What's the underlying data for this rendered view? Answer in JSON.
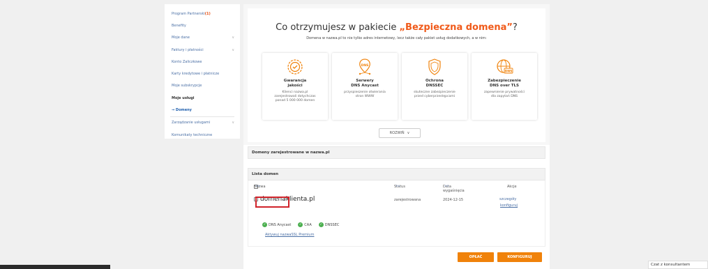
{
  "sidebar": {
    "items": [
      {
        "label": "Program Partnerski",
        "badge": "(1)",
        "chev": false,
        "style": "normal"
      },
      {
        "label": "Benefity",
        "chev": false,
        "style": "normal"
      },
      {
        "label": "Moje dane",
        "chev": true,
        "style": "normal"
      },
      {
        "label": "Faktury i płatności",
        "chev": true,
        "style": "normal"
      },
      {
        "label": "Konto Zaliczkowe",
        "chev": false,
        "style": "normal"
      },
      {
        "label": "Karty kredytowe i płatnicze",
        "chev": false,
        "style": "normal"
      },
      {
        "label": "Moje subskrypcje",
        "chev": false,
        "style": "normal"
      },
      {
        "label": "Moje usługi",
        "chev": false,
        "style": "bold"
      },
      {
        "label": "→ Domeny",
        "chev": false,
        "style": "sub"
      },
      {
        "label": "Zarządzanie usługami",
        "chev": true,
        "style": "normal"
      },
      {
        "label": "Komunikaty techniczne",
        "chev": false,
        "style": "normal"
      }
    ]
  },
  "promo": {
    "title_pre": "Co otrzymujesz w pakiecie ",
    "title_hl": "„Bezpieczna domena”",
    "title_post": "?",
    "subtitle": "Domena w nazwa.pl to nie tylko adres internetowy, lecz także cały pakiet usług dodatkowych, a w nim:",
    "cards": [
      {
        "title": "Gwarancja\njakości",
        "desc": "Klienci nazwa.pl\nzarejestrowali dotychczas\nponad 5 000 000 domen",
        "icon": "quality-badge-icon"
      },
      {
        "title": "Serwery\nDNS Anycast",
        "desc": "przyspieszenie otwierania\nstron WWW",
        "icon": "dns-pin-icon"
      },
      {
        "title": "Ochrona\nDNSSEC",
        "desc": "skuteczne zabezpieczenie\nprzed cyberprzestępcami",
        "icon": "shield-icon"
      },
      {
        "title": "Zabezpieczenie\nDNS over TLS",
        "desc": "zapewnienie prywatności\ndla zapytań DNS",
        "icon": "globe-dns-icon"
      }
    ],
    "expand_label": "ROZWIŃ"
  },
  "registered_bar": "Domeny zarejestrowane w nazwa.pl",
  "list": {
    "title": "Lista domen",
    "headers": {
      "name": "Nazwa",
      "status": "Status",
      "expiry": "Data wygaśnięcia",
      "actions": "Akcje"
    },
    "rows": [
      {
        "domain": "domenaklienta.pl",
        "status": "zarejestrowana",
        "expiry": "2024-12-15",
        "action1": "szczegóły",
        "action2": "konfiguruj",
        "features": [
          "DNS Anycast",
          "CAA",
          "DNSSEC"
        ],
        "ssl_link": "Aktywuj nazwaSSL Premium"
      }
    ]
  },
  "buttons": {
    "pay": "OPŁAĆ",
    "configure": "KONFIGURUJ"
  },
  "chat": "Czat z konsultantem",
  "colors": {
    "accent": "#f0820a",
    "highlight": "#f05a1a",
    "link": "#4a6fa5",
    "ok": "#4caf50",
    "red_box": "#d0232a"
  }
}
